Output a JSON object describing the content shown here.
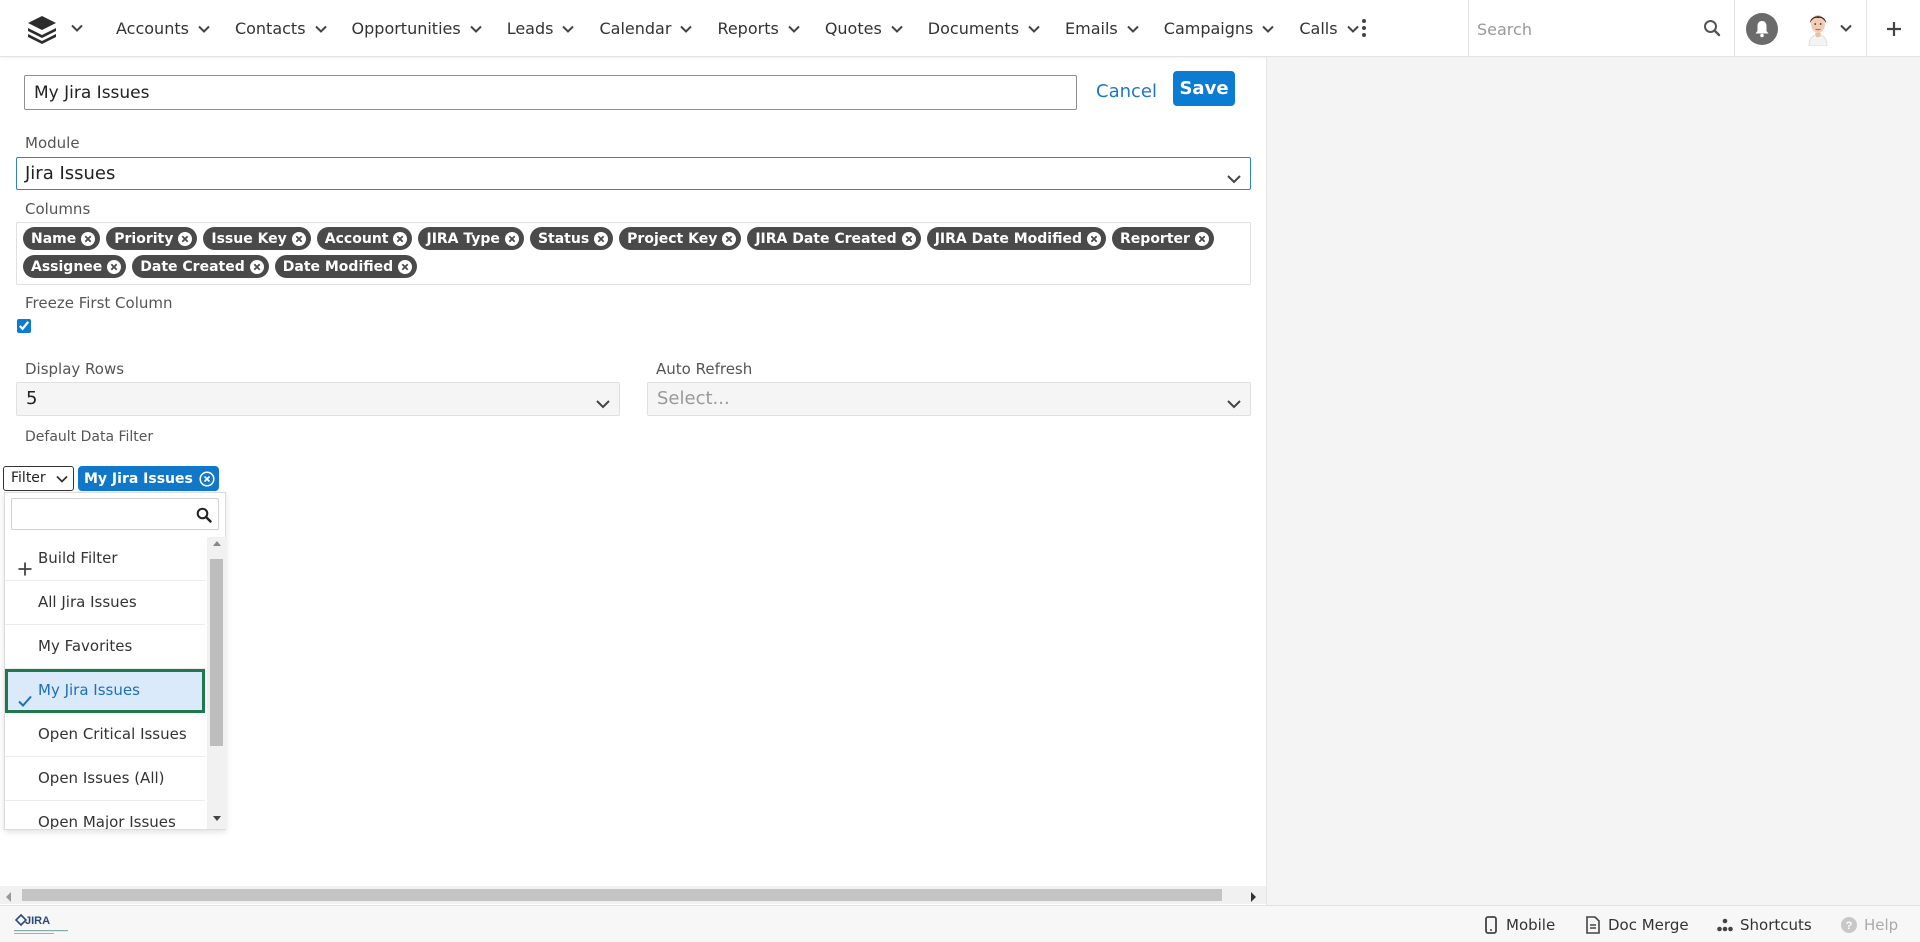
{
  "nav": {
    "items": [
      {
        "label": "Accounts"
      },
      {
        "label": "Contacts"
      },
      {
        "label": "Opportunities"
      },
      {
        "label": "Leads"
      },
      {
        "label": "Calendar"
      },
      {
        "label": "Reports"
      },
      {
        "label": "Quotes"
      },
      {
        "label": "Documents"
      },
      {
        "label": "Emails"
      },
      {
        "label": "Campaigns"
      },
      {
        "label": "Calls"
      }
    ],
    "search_placeholder": "Search"
  },
  "form": {
    "title_value": "My Jira Issues",
    "cancel_label": "Cancel",
    "save_label": "Save",
    "module_label": "Module",
    "module_value": "Jira Issues",
    "columns_label": "Columns",
    "columns": [
      "Name",
      "Priority",
      "Issue Key",
      "Account",
      "JIRA Type",
      "Status",
      "Project Key",
      "JIRA Date Created",
      "JIRA Date Modified",
      "Reporter",
      "Assignee",
      "Date Created",
      "Date Modified"
    ],
    "freeze_label": "Freeze First Column",
    "freeze_checked": true,
    "display_rows_label": "Display Rows",
    "display_rows_value": "5",
    "auto_refresh_label": "Auto Refresh",
    "auto_refresh_placeholder": "Select...",
    "default_filter_label": "Default Data Filter",
    "filter_button_label": "Filter",
    "active_filter": "My Jira Issues"
  },
  "dropdown": {
    "items": [
      {
        "label": "Build Filter",
        "type": "build"
      },
      {
        "label": "All Jira Issues"
      },
      {
        "label": "My Favorites"
      },
      {
        "label": "My Jira Issues",
        "selected": true
      },
      {
        "label": "Open Critical Issues"
      },
      {
        "label": "Open Issues (All)"
      },
      {
        "label": "Open Major Issues"
      }
    ]
  },
  "footer": {
    "logo_text": "JIRA",
    "mobile_label": "Mobile",
    "doc_merge_label": "Doc Merge",
    "shortcuts_label": "Shortcuts",
    "help_label": "Help"
  },
  "colors": {
    "primary": "#0c7bd2",
    "link": "#1f77c3",
    "pill_dark": "#4a4a4a",
    "selected_outline": "#1d7a4c",
    "selected_bg": "#dbeafb"
  }
}
